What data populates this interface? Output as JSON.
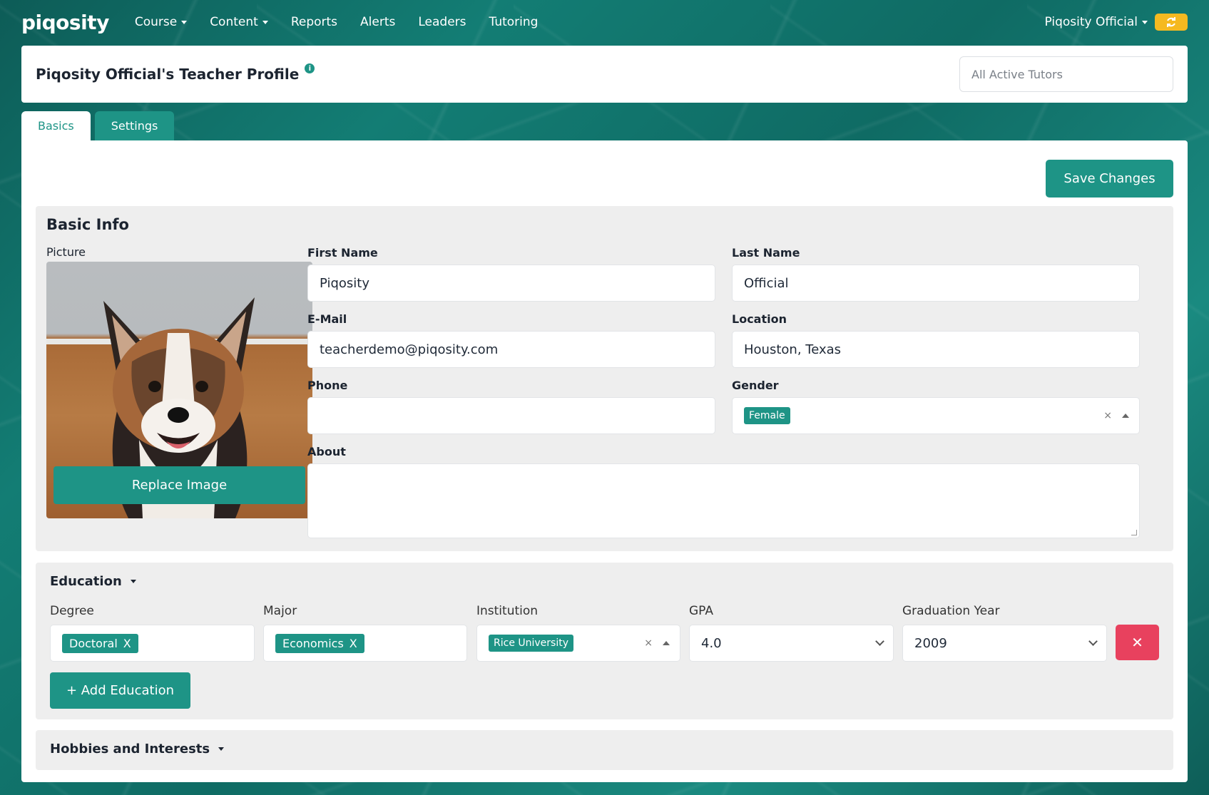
{
  "nav": {
    "logo": "piqosity",
    "items": [
      {
        "label": "Course",
        "dropdown": true
      },
      {
        "label": "Content",
        "dropdown": true
      },
      {
        "label": "Reports",
        "dropdown": false
      },
      {
        "label": "Alerts",
        "dropdown": false
      },
      {
        "label": "Leaders",
        "dropdown": false
      },
      {
        "label": "Tutoring",
        "dropdown": false
      }
    ],
    "user_menu": "Piqosity Official",
    "refresh_icon": "refresh-icon"
  },
  "header": {
    "title": "Piqosity Official's Teacher Profile",
    "info_icon": "i",
    "tutor_select_placeholder": "All Active Tutors"
  },
  "tabs": [
    {
      "label": "Basics",
      "active": true
    },
    {
      "label": "Settings",
      "active": false
    }
  ],
  "save_label": "Save Changes",
  "basic_info": {
    "title": "Basic Info",
    "picture_label": "Picture",
    "replace_label": "Replace Image",
    "first_name": {
      "label": "First Name",
      "value": "Piqosity"
    },
    "last_name": {
      "label": "Last Name",
      "value": "Official"
    },
    "email": {
      "label": "E-Mail",
      "value": "teacherdemo@piqosity.com"
    },
    "location": {
      "label": "Location",
      "value": "Houston, Texas"
    },
    "phone": {
      "label": "Phone",
      "value": ""
    },
    "gender": {
      "label": "Gender",
      "value": "Female",
      "clear": "×"
    },
    "about": {
      "label": "About",
      "value": ""
    }
  },
  "education": {
    "title": "Education",
    "columns": [
      "Degree",
      "Major",
      "Institution",
      "GPA",
      "Graduation Year"
    ],
    "row": {
      "degree": "Doctoral",
      "major": "Economics",
      "institution": "Rice University",
      "gpa": "4.0",
      "year": "2009",
      "chip_remove": "X",
      "clear": "×",
      "remove": "✕"
    },
    "add_label": "+ Add Education"
  },
  "hobbies": {
    "title": "Hobbies and Interests"
  },
  "colors": {
    "accent": "#1e9486",
    "danger": "#e8415e",
    "warning": "#f5b920"
  }
}
